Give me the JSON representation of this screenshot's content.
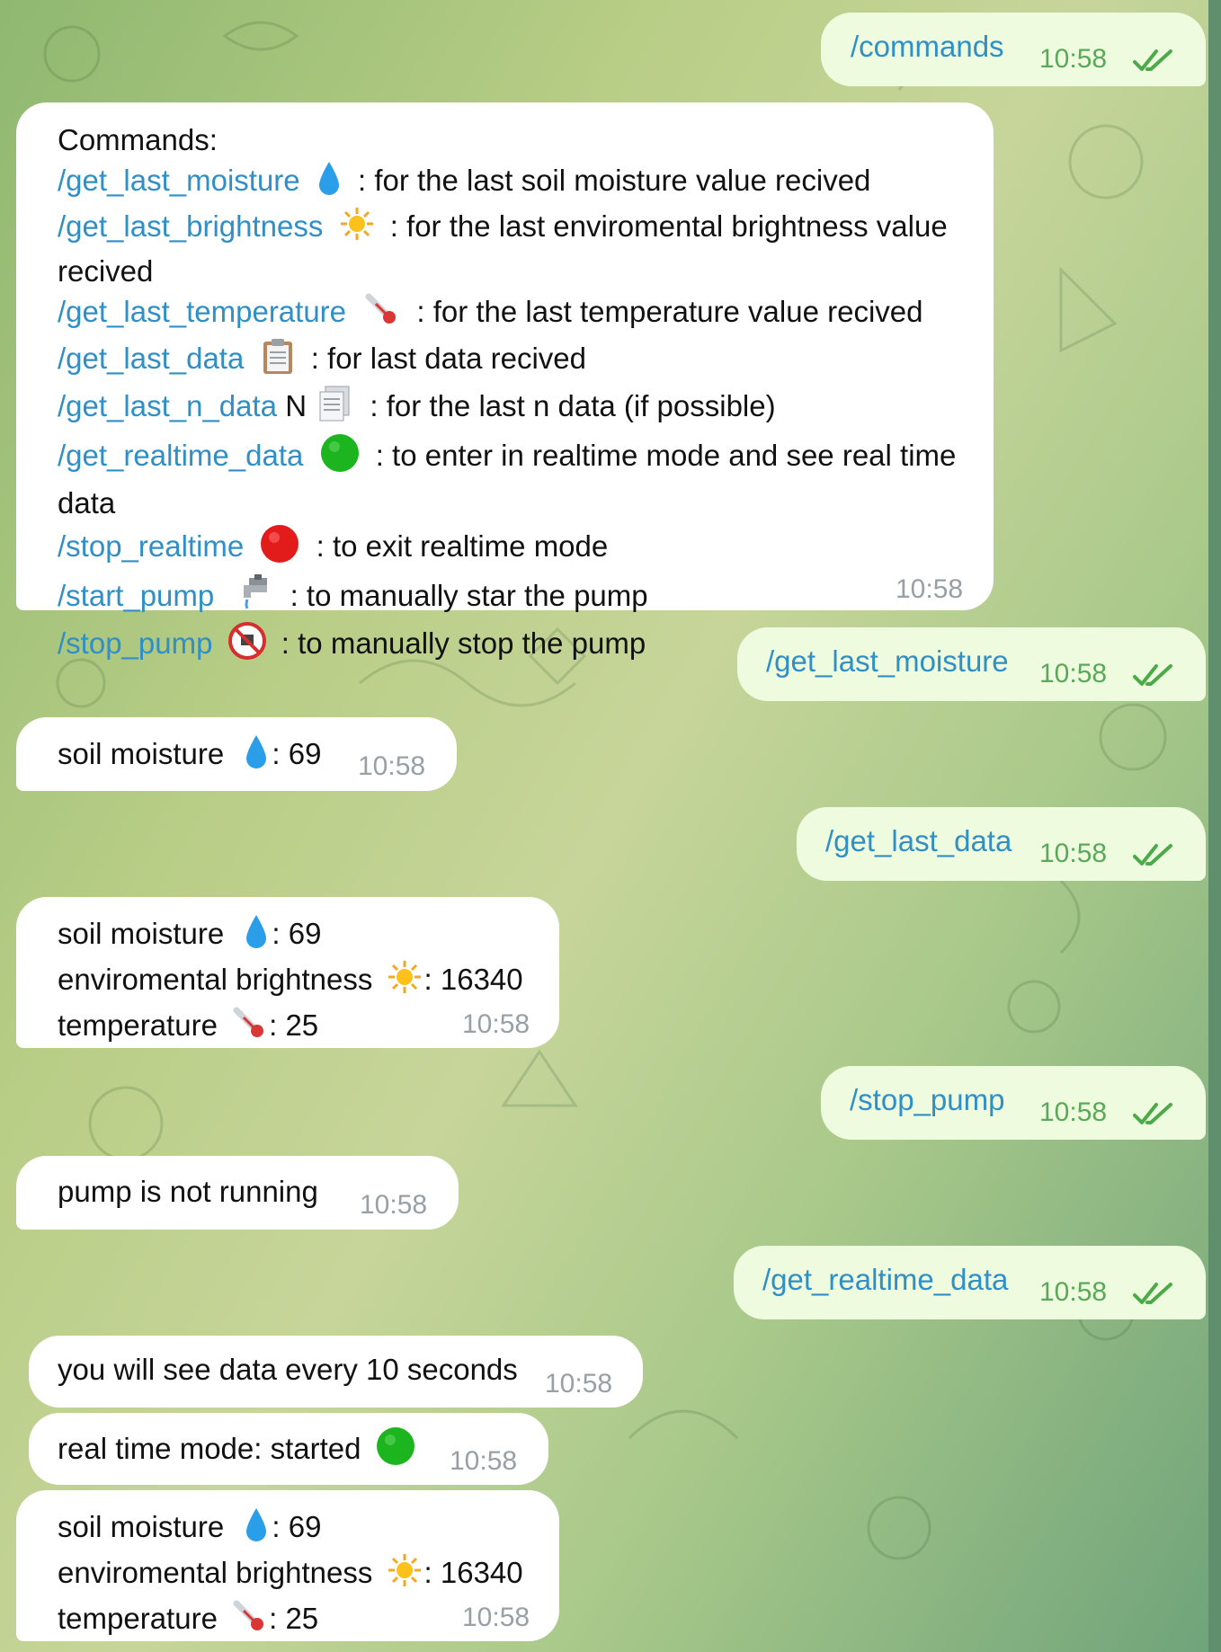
{
  "colors": {
    "link": "#2f8fc6",
    "outgoing_bubble": "#eefbdf",
    "incoming_bubble": "#ffffff",
    "read_check": "#4caa4a"
  },
  "messages": [
    {
      "dir": "out",
      "text": "/commands",
      "time": "10:58",
      "status": "read"
    },
    {
      "dir": "in",
      "title": "Commands:",
      "commands": [
        {
          "cmd": "/get_last_moisture",
          "icon": "droplet-icon",
          "desc": " : for the last soil moisture value recived"
        },
        {
          "cmd": "/get_last_brightness",
          "icon": "sun-icon",
          "desc": " : for the last enviromental brightness value recived"
        },
        {
          "cmd": "/get_last_temperature",
          "icon": "thermometer-icon",
          "desc": " : for the last temperature value recived"
        },
        {
          "cmd": "/get_last_data",
          "icon": "clipboard-icon",
          "desc": " : for last data recived"
        },
        {
          "cmd": "/get_last_n_data",
          "extra": " N",
          "icon": "documents-icon",
          "desc": " : for the last n data (if possible)"
        },
        {
          "cmd": "/get_realtime_data",
          "icon": "green-circle-icon",
          "desc": " : to enter in realtime mode and see real time data"
        },
        {
          "cmd": "/stop_realtime",
          "icon": "red-circle-icon",
          "desc": " : to exit realtime mode"
        },
        {
          "cmd": "/start_pump",
          "icon": "faucet-icon",
          "desc": " : to manually star the pump"
        },
        {
          "cmd": "/stop_pump",
          "icon": "no-water-icon",
          "desc": " : to manually stop the pump"
        }
      ],
      "time": "10:58"
    },
    {
      "dir": "out",
      "text": "/get_last_moisture",
      "time": "10:58",
      "status": "read"
    },
    {
      "dir": "in",
      "label": "soil moisture",
      "value": ": 69",
      "icon": "droplet-icon",
      "time": "10:58"
    },
    {
      "dir": "out",
      "text": "/get_last_data",
      "time": "10:58",
      "status": "read"
    },
    {
      "dir": "in",
      "rows": [
        {
          "label": "soil moisture",
          "icon": "droplet-icon",
          "value": ": 69"
        },
        {
          "label": "enviromental brightness",
          "icon": "sun-icon",
          "value": ": 16340"
        },
        {
          "label": "temperature",
          "icon": "thermometer-icon",
          "value": ": 25"
        }
      ],
      "time": "10:58"
    },
    {
      "dir": "out",
      "text": "/stop_pump",
      "time": "10:58",
      "status": "read"
    },
    {
      "dir": "in",
      "text": "pump is not running",
      "time": "10:58"
    },
    {
      "dir": "out",
      "text": "/get_realtime_data",
      "time": "10:58",
      "status": "read"
    },
    {
      "dir": "in",
      "text": "you will see data every 10 seconds",
      "time": "10:58"
    },
    {
      "dir": "in",
      "text": "real time mode: started",
      "icon": "green-circle-icon",
      "time": "10:58"
    },
    {
      "dir": "in",
      "rows": [
        {
          "label": "soil moisture",
          "icon": "droplet-icon",
          "value": ": 69"
        },
        {
          "label": "enviromental brightness",
          "icon": "sun-icon",
          "value": ": 16340"
        },
        {
          "label": "temperature",
          "icon": "thermometer-icon",
          "value": ": 25"
        }
      ],
      "time": "10:58"
    }
  ]
}
